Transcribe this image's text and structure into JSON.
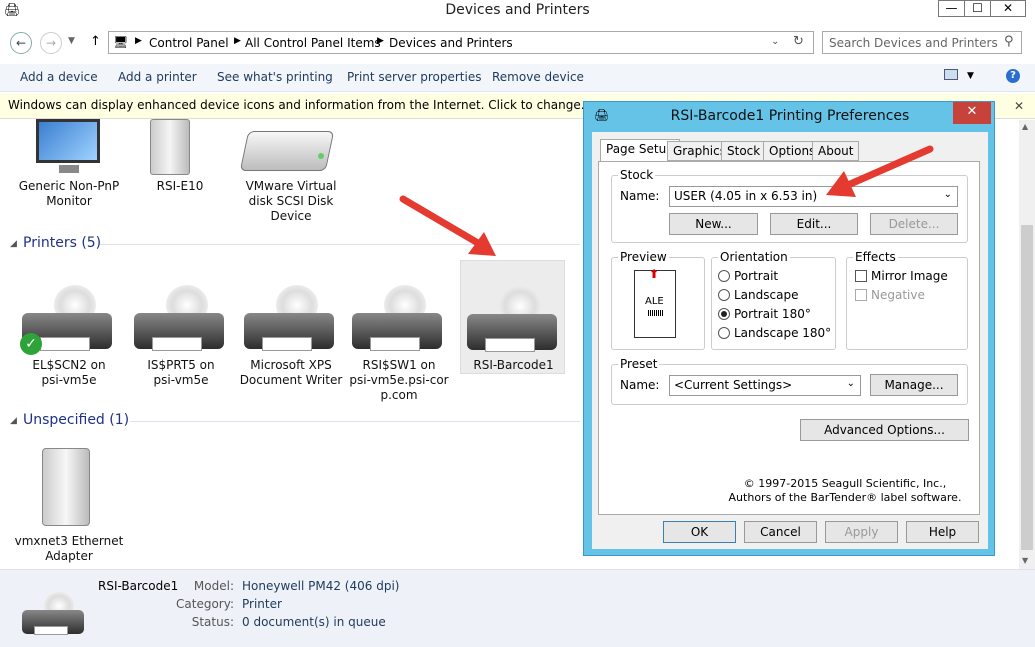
{
  "window": {
    "title": "Devices and Printers",
    "minimize": "—",
    "maximize": "☐",
    "close": "✕"
  },
  "address": {
    "crumbs": [
      "Control Panel",
      "All Control Panel Items",
      "Devices and Printers"
    ],
    "search_placeholder": "Search Devices and Printers"
  },
  "commands": [
    "Add a device",
    "Add a printer",
    "See what's printing",
    "Print server properties",
    "Remove device"
  ],
  "infobar": {
    "text": "Windows can display enhanced device icons and information from the Internet. Click to change..."
  },
  "devices": [
    {
      "label": "Generic Non-PnP\nMonitor"
    },
    {
      "label": "RSI-E10"
    },
    {
      "label": "VMware Virtual\ndisk SCSI Disk\nDevice"
    }
  ],
  "printers_group": "Printers (5)",
  "printers": [
    {
      "label": "EL$SCN2 on\npsi-vm5e",
      "default": true
    },
    {
      "label": "IS$PRT5 on\npsi-vm5e"
    },
    {
      "label": "Microsoft XPS\nDocument Writer"
    },
    {
      "label": "RSI$SW1 on\npsi-vm5e.psi-cor\np.com"
    },
    {
      "label": "RSI-Barcode1",
      "selected": true
    }
  ],
  "unspecified_group": "Unspecified (1)",
  "unspecified": [
    {
      "label": "vmxnet3 Ethernet\nAdapter"
    }
  ],
  "details": {
    "name": "RSI-Barcode1",
    "rows": [
      {
        "key": "Model:",
        "value": "Honeywell PM42 (406 dpi)"
      },
      {
        "key": "Category:",
        "value": "Printer"
      },
      {
        "key": "Status:",
        "value": "0 document(s) in queue"
      }
    ]
  },
  "dialog": {
    "title": "RSI-Barcode1 Printing Preferences",
    "tabs": [
      "Page Setup",
      "Graphics",
      "Stock",
      "Options",
      "About"
    ],
    "stock": {
      "group": "Stock",
      "name_label": "Name:",
      "value": "USER (4.05 in x 6.53 in)",
      "new": "New...",
      "edit": "Edit...",
      "delete": "Delete..."
    },
    "preview": {
      "group": "Preview",
      "sample": "ALE"
    },
    "orientation": {
      "group": "Orientation",
      "options": [
        "Portrait",
        "Landscape",
        "Portrait 180°",
        "Landscape 180°"
      ],
      "selected": 2
    },
    "effects": {
      "group": "Effects",
      "mirror": "Mirror Image",
      "negative": "Negative"
    },
    "preset": {
      "group": "Preset",
      "name_label": "Name:",
      "value": "<Current Settings>",
      "manage": "Manage..."
    },
    "advanced": "Advanced Options...",
    "copyright1": "© 1997-2015 Seagull Scientific, Inc.,",
    "copyright2": "Authors of the BarTender® label software.",
    "ok": "OK",
    "cancel": "Cancel",
    "apply": "Apply",
    "help": "Help"
  }
}
